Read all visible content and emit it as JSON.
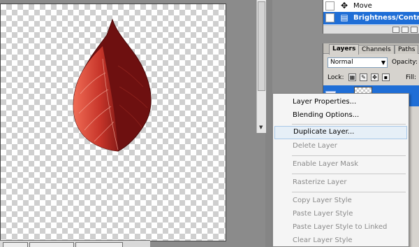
{
  "history": {
    "items": [
      {
        "icon": "move-icon",
        "label": "Move",
        "selected": false
      },
      {
        "icon": "adjustment-layer-icon",
        "label": "Brightness/Contrast",
        "selected": true
      }
    ]
  },
  "layers_panel": {
    "tabs": [
      {
        "label": "Layers",
        "active": true
      },
      {
        "label": "Channels",
        "active": false
      },
      {
        "label": "Paths",
        "active": false
      }
    ],
    "blend_mode": "Normal",
    "opacity_label": "Opacity:",
    "lock_label": "Lock:",
    "fill_label": "Fill:"
  },
  "context_menu": {
    "items": [
      {
        "label": "Layer Properties...",
        "enabled": true
      },
      {
        "label": "Blending Options...",
        "enabled": true
      },
      {
        "separator": true
      },
      {
        "label": "Duplicate Layer...",
        "enabled": true,
        "hover": true
      },
      {
        "label": "Delete Layer",
        "enabled": false
      },
      {
        "separator": true
      },
      {
        "label": "Enable Layer Mask",
        "enabled": false
      },
      {
        "separator": true
      },
      {
        "label": "Rasterize Layer",
        "enabled": false
      },
      {
        "separator": true
      },
      {
        "label": "Copy Layer Style",
        "enabled": false
      },
      {
        "label": "Paste Layer Style",
        "enabled": false
      },
      {
        "label": "Paste Layer Style to Linked",
        "enabled": false
      },
      {
        "label": "Clear Layer Style",
        "enabled": false
      }
    ]
  },
  "colors": {
    "selection": "#1f6ed6",
    "leaf_dark": "#6e1010",
    "leaf_light": "#e2553f"
  }
}
